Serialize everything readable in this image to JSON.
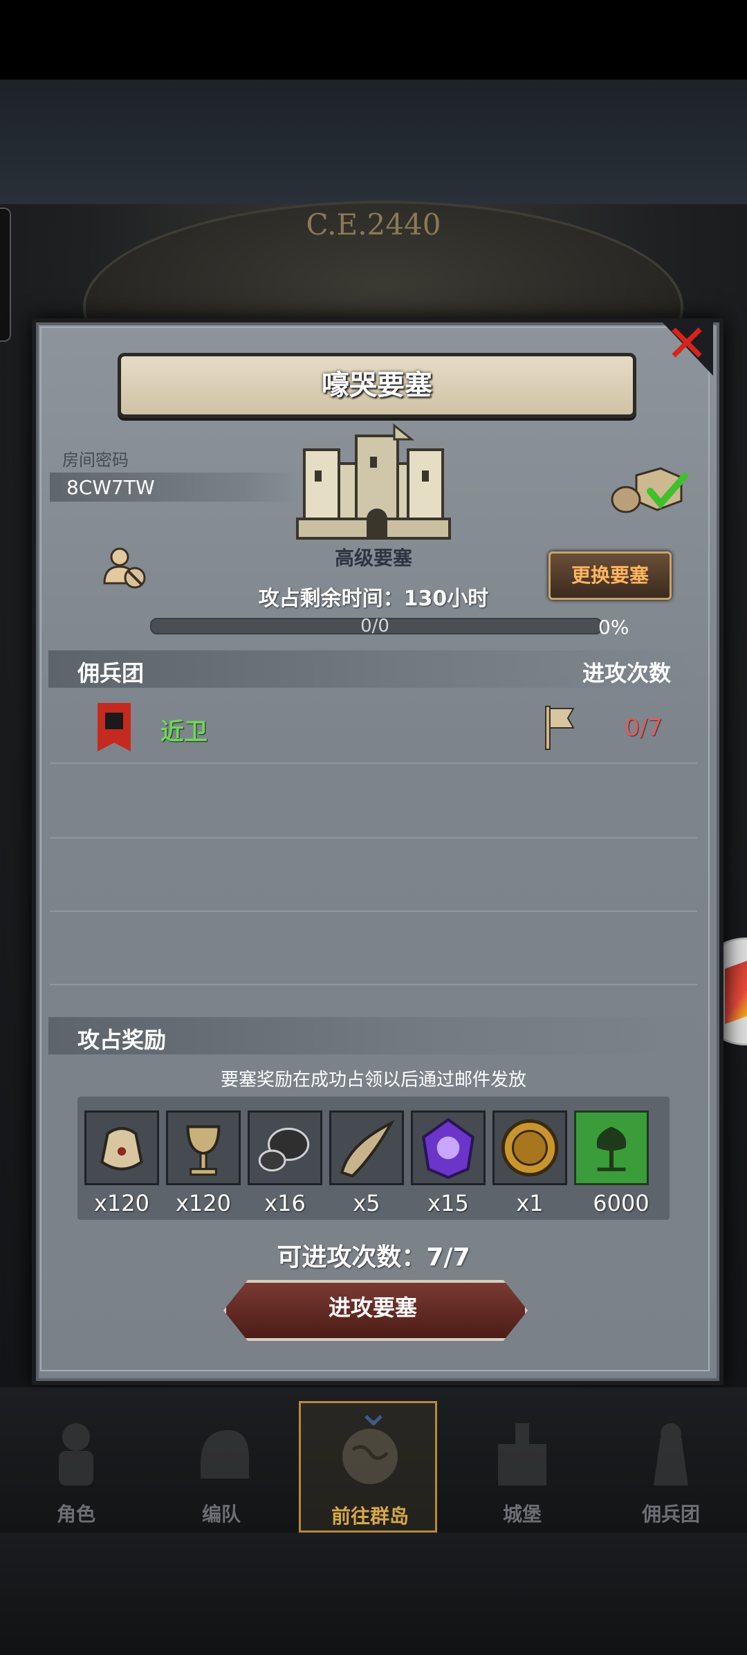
{
  "background": {
    "year": "C.E.2440"
  },
  "dialog": {
    "title": "嚎哭要塞",
    "room_label": "房间密码",
    "room_code": "8CW7TW",
    "fortress_level": "高级要塞",
    "change_button": "更换要塞",
    "remaining_time": "攻占剩余时间：130小时",
    "progress_text": "0/0",
    "progress_percent": "0%",
    "progress_fraction": 0,
    "headers": {
      "left": "佣兵团",
      "right": "进攻次数"
    },
    "guild": {
      "name": "近卫",
      "attacks": "0/7"
    },
    "reward_title": "攻占奖励",
    "reward_note": "要塞奖励在成功占领以后通过邮件发放",
    "rewards": [
      {
        "icon": "sack-icon",
        "count": "x120"
      },
      {
        "icon": "goblet-icon",
        "count": "x120"
      },
      {
        "icon": "ore-icon",
        "count": "x16"
      },
      {
        "icon": "horn-icon",
        "count": "x5"
      },
      {
        "icon": "purple-crystal-icon",
        "count": "x15"
      },
      {
        "icon": "gold-medal-icon",
        "count": "x1"
      },
      {
        "icon": "guild-banner-icon",
        "count": "6000"
      }
    ],
    "can_attack": "可进攻次数：7/7",
    "attack_button": "进攻要塞"
  },
  "nav": [
    {
      "label": "角色",
      "icon": "knight-icon"
    },
    {
      "label": "编队",
      "icon": "helmet-icon"
    },
    {
      "label": "前往群岛",
      "icon": "globe-icon",
      "active": true
    },
    {
      "label": "城堡",
      "icon": "castle-icon"
    },
    {
      "label": "佣兵团",
      "icon": "mercenary-icon"
    }
  ],
  "colors": {
    "accent": "#d8a848",
    "guild": "#6ed857",
    "warning": "#e65a5a"
  }
}
